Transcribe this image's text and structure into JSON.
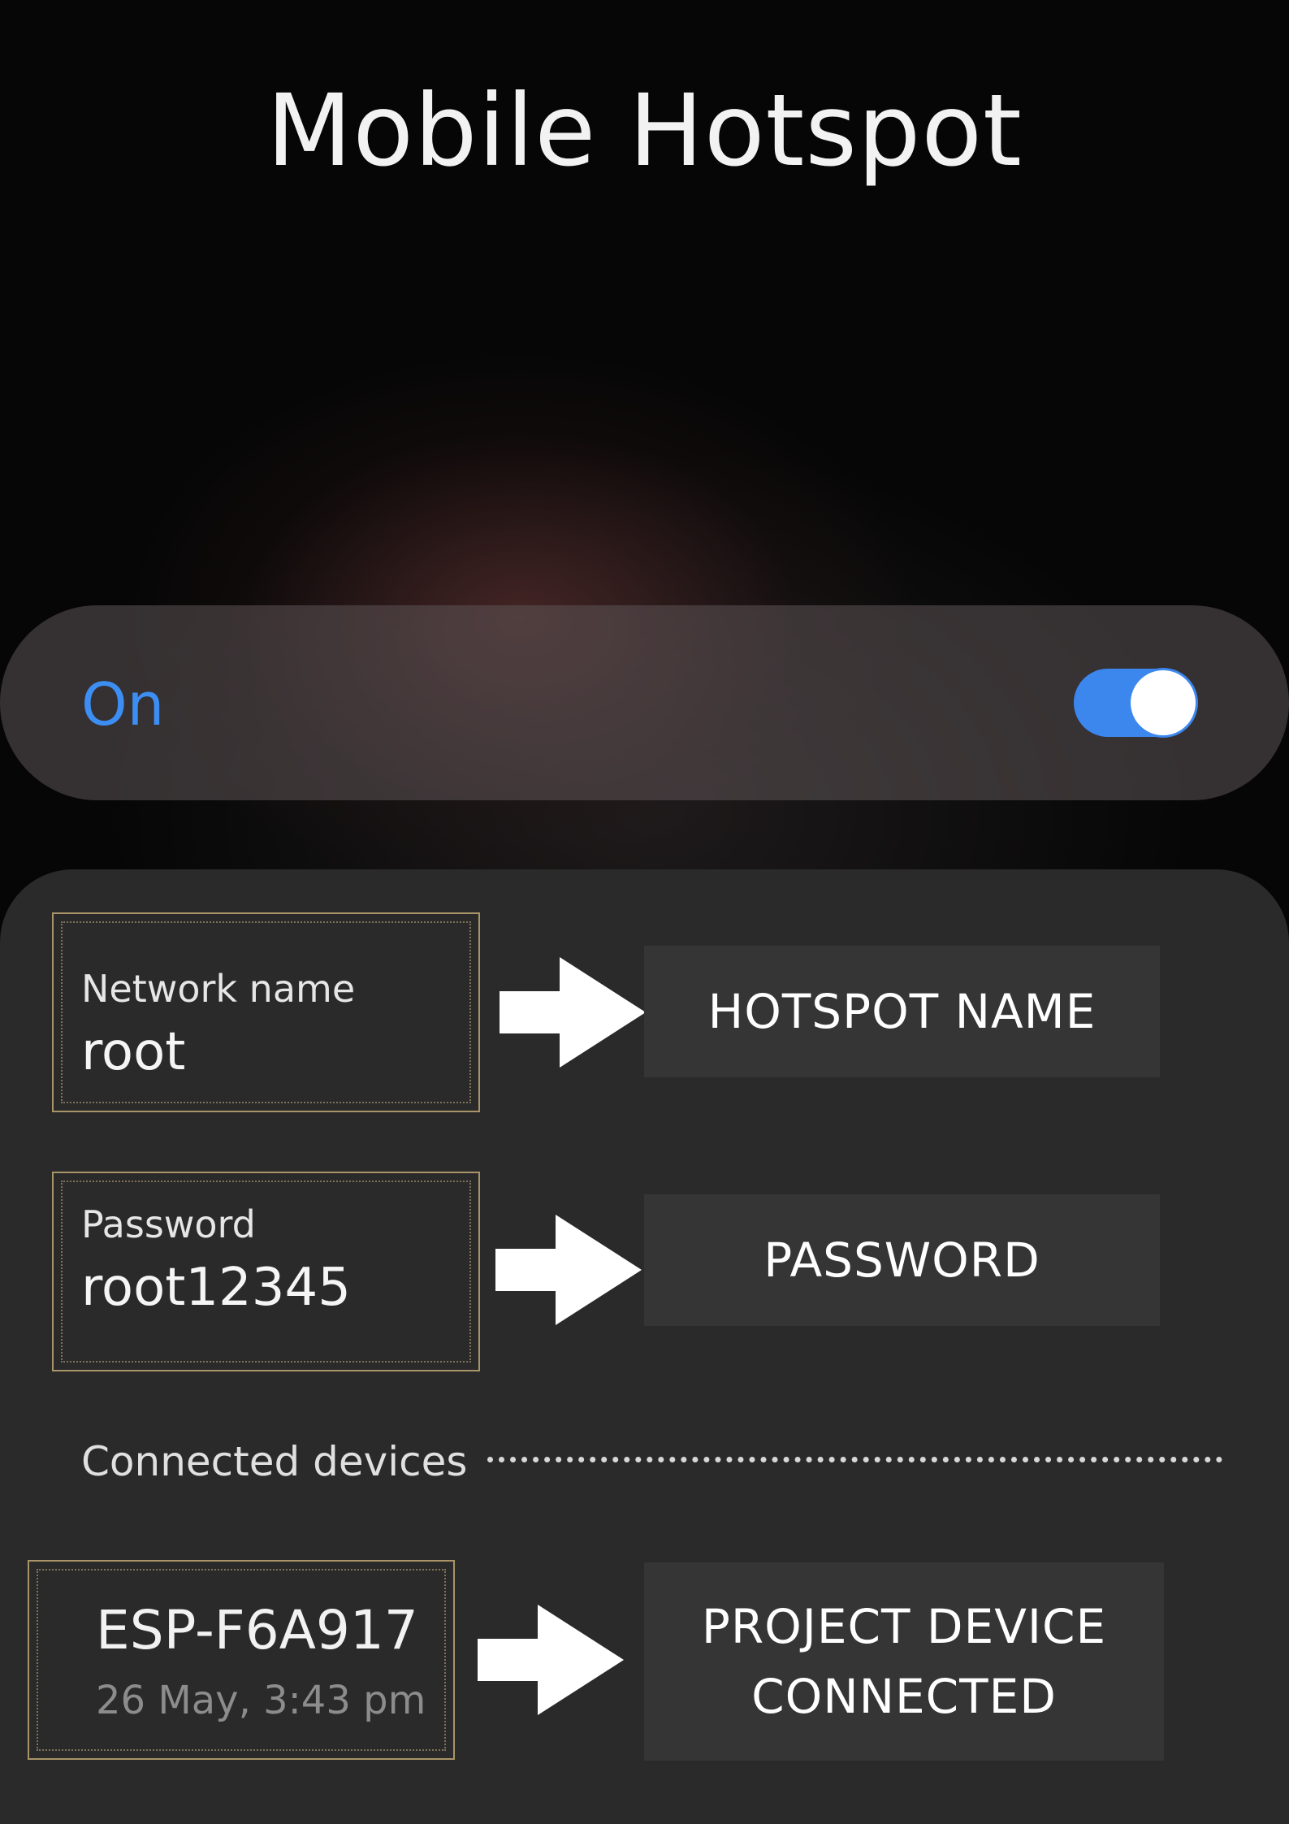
{
  "header": {
    "title": "Mobile Hotspot"
  },
  "hotspot_toggle": {
    "label": "On",
    "state": "on",
    "accent_color": "#3b87ee"
  },
  "fields": [
    {
      "label": "Network name",
      "value": "root",
      "annotation": "HOTSPOT NAME"
    },
    {
      "label": "Password",
      "value": "root12345",
      "annotation": "PASSWORD"
    }
  ],
  "connected_devices": {
    "heading": "Connected devices",
    "devices": [
      {
        "name": "ESP-F6A917",
        "connected_time": "26 May, 3:43 pm",
        "annotation_line1": "PROJECT DEVICE",
        "annotation_line2": "CONNECTED"
      }
    ]
  },
  "icons": {
    "arrow": "right-arrow-icon",
    "toggle": "toggle-switch"
  }
}
